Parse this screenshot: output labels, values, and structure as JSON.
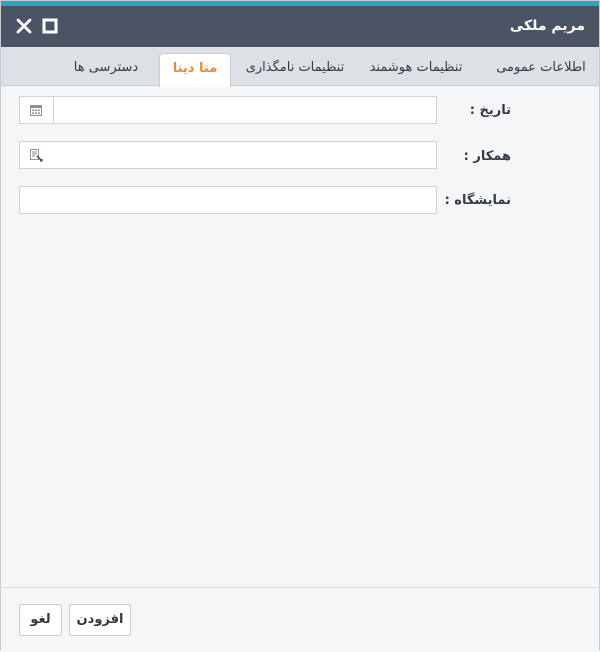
{
  "window": {
    "title": "مریم ملکی",
    "accent_color": "#2aa8b8",
    "titlebar_color": "#4a5464"
  },
  "tabs": [
    {
      "label": "اطلاعات عمومی",
      "active": false
    },
    {
      "label": "تنظیمات هوشمند",
      "active": false
    },
    {
      "label": "تنظیمات نامگذاری",
      "active": false
    },
    {
      "label": "متا دیتا",
      "active": true
    },
    {
      "label": "دسترسی ها",
      "active": false
    }
  ],
  "active_tab_color": "#ef8a2e",
  "form": {
    "date_label": "تاریخ :",
    "date_value": "",
    "date_icon": "calendar-icon",
    "colleague_label": "همکار :",
    "colleague_value": "",
    "colleague_icon": "lookup-icon",
    "exhibition_label": "نمایشگاه :",
    "exhibition_value": ""
  },
  "footer": {
    "add_label": "افزودن",
    "cancel_label": "لغو"
  }
}
